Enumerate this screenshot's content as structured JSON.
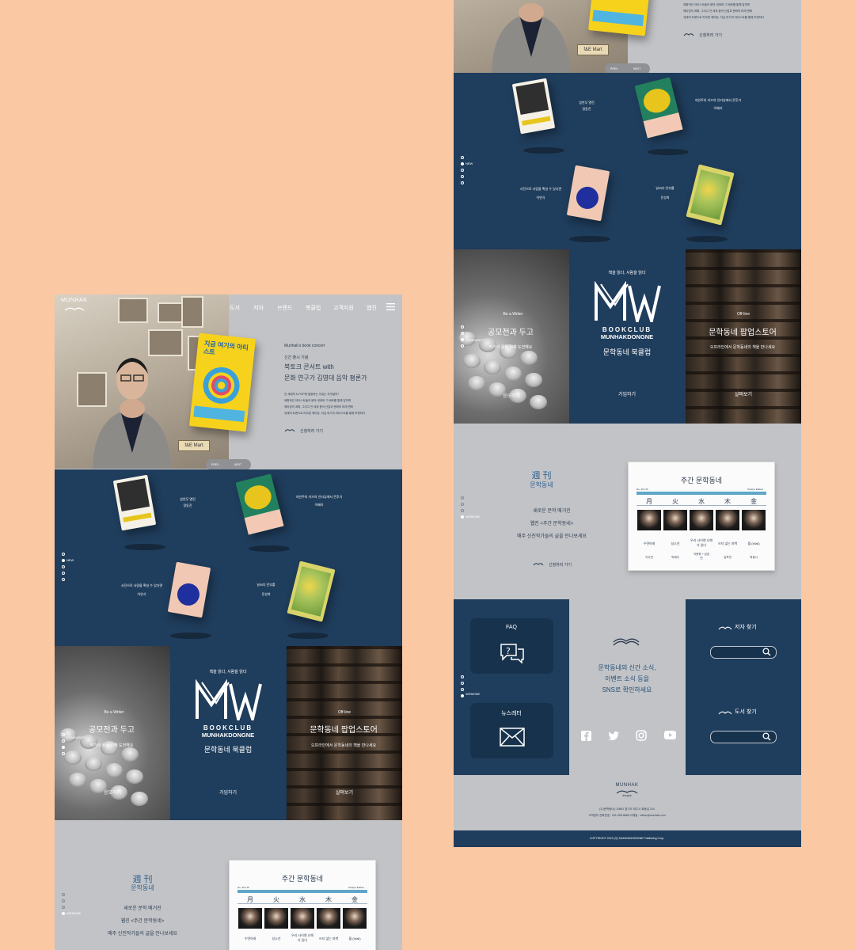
{
  "colors": {
    "background": "#fbc8a4",
    "navy": "#1f3d5c",
    "grey": "#c2c3c6"
  },
  "logo": {
    "line1": "MUNHAK",
    "line2": "dongne"
  },
  "nav": {
    "items": [
      "도서",
      "저자",
      "브랜드",
      "북클럽",
      "고객지원",
      "웹진"
    ],
    "menu_icon": "hamburger-icon"
  },
  "hero": {
    "eyebrow": "Munhak's book concert",
    "label": "신간 출시 기념",
    "title1": "북토크 콘서트 with",
    "title2": "문화 연구가 김영대 음악 평론가",
    "body": [
      "전 세계적 K-POP에 열광하는 이유는 무엇일까?",
      "매혹적인 아티스트들의 음악 세계와 그 배후를 통해 답하며",
      "메타장의 계획, 그리고 전 세계 음악 산업과 문화의 미래 변화",
      "세계적 트렌드로 떠오른 메타장, 지금 여기의 아티스트를 통해 조명하다"
    ],
    "link": "신청하러 가기",
    "prev": "PREV",
    "next": "NEXT",
    "book_cover": "지금 여기의 아티스트"
  },
  "new_books": {
    "tag": "NEW",
    "items": [
      {
        "title": "암연무 열린",
        "author": "정동진"
      },
      {
        "title": "자연주의 키즈의 인터뷰에서 몬후기",
        "author": "이혜리"
      },
      {
        "title": "사진으로 사람을 확실 수 있다면",
        "author": "이연식"
      },
      {
        "title": "날씨다 안부를",
        "author": "윤성희"
      }
    ]
  },
  "bookclub": {
    "left_sub": "Be a Writer",
    "left_title": "공모전과 두고",
    "left_desc": "작가의 꿈을 위해 도전해요",
    "left_tag": "COMMUNITY",
    "left_link": "응모하기",
    "center_tagline": "책을 읽다, 사람을 읽다",
    "logo_mark": "MW",
    "logo_line1": "BOOKCLUB",
    "logo_line2": "MUNHAKDONGNE",
    "center_name": "문학동네 북클럽",
    "center_link": "가입하기",
    "right_sub": "Off-line",
    "right_title": "문학동네 팝업스토어",
    "right_desc": "오프라인에서 문학동네의 책을 만나세요",
    "right_link": "살펴보기"
  },
  "webzine": {
    "hanja": "週  刊",
    "name": "문학동네",
    "tag": "WEBZINE",
    "line1": "새로운 문학 매거진",
    "line2": "웹진 <주간 문학동네>",
    "line3": "매주 신진작가들의 글을 만나보세요",
    "link": "신청하러 가기",
    "paper_title": "주간 문학동네",
    "paper_no": "No. 46,716",
    "paper_edition": "Today's Edition",
    "days": [
      "月",
      "火",
      "水",
      "木",
      "金"
    ],
    "titles": [
      "수면아래",
      "성소년",
      "우리 사이엔 오해가 있다",
      "쓰지 않는 처벽",
      "월 (Wall)"
    ],
    "authors": [
      "이주연",
      "박제주",
      "이종희 + 남궁민",
      "김보연",
      "최경나"
    ]
  },
  "support": {
    "faq": "FAQ",
    "newsletter": "뉴스레터",
    "sns_text": [
      "문학동네의 신간 소식,",
      "이벤트 소식 등을",
      "SNS로 확인하세요"
    ],
    "tag": "WEBZINE",
    "author_search": "저자 찾기",
    "book_search": "도서 찾기"
  },
  "footer": {
    "logo1": "MUNHAK",
    "logo2": "dongne",
    "address": "(주)문학동네 | 10881 경기도 파주시 회동길 210",
    "contact": "고객센터 전화번호 : 031-955-8888   이메일 : editor@munhak.com",
    "copyright": "COPYRIGHT 2019 (주) MUNHAKDONGNE Publishing Corp."
  }
}
